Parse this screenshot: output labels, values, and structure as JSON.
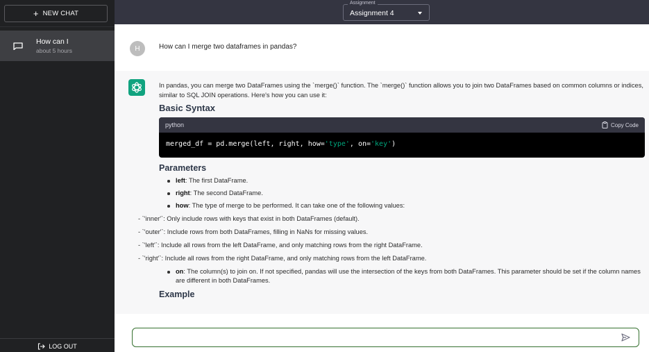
{
  "sidebar": {
    "new_chat_label": "NEW CHAT",
    "chats": [
      {
        "title": "How can I",
        "time": "about 5 hours"
      }
    ],
    "logout_label": "LOG OUT"
  },
  "header": {
    "assignment_label": "Assignment",
    "assignment_value": "Assignment 4"
  },
  "messages": {
    "user": {
      "avatar_letter": "H",
      "text": "How can I merge two dataframes in pandas?"
    },
    "assistant": {
      "intro": "In pandas, you can merge two DataFrames using the `merge()` function. The `merge()` function allows you to join two DataFrames based on common columns or indices, similar to SQL JOIN operations. Here's how you can use it:",
      "heading_basic": "Basic Syntax",
      "code": {
        "language": "python",
        "copy_label": "Copy Code",
        "part1": "merged_df = pd.merge(left, right, how=",
        "str1": "'type'",
        "part2": ", on=",
        "str2": "'key'",
        "part3": ")"
      },
      "heading_params": "Parameters",
      "params": [
        {
          "name": "left",
          "desc": ": The first DataFrame."
        },
        {
          "name": "right",
          "desc": ": The second DataFrame."
        },
        {
          "name": "how",
          "desc": ": The type of merge to be performed. It can take one of the following values:"
        }
      ],
      "how_values": [
        "- `'inner'`: Only include rows with keys that exist in both DataFrames (default).",
        "- `'outer'`: Include rows from both DataFrames, filling in NaNs for missing values.",
        "- `'left'`: Include all rows from the left DataFrame, and only matching rows from the right DataFrame.",
        "- `'right'`: Include all rows from the right DataFrame, and only matching rows from the left DataFrame."
      ],
      "param_on": {
        "name": "on",
        "desc": ": The column(s) to join on. If not specified, pandas will use the intersection of the keys from both DataFrames. This parameter should be set if the column names are different in both DataFrames."
      },
      "heading_example": "Example"
    }
  },
  "input": {
    "value": "",
    "placeholder": ""
  },
  "colors": {
    "sidebar_bg": "#202123",
    "header_bg": "#343541",
    "assistant_bg": "#f7f7f8",
    "gpt_avatar": "#10a37f",
    "input_border": "#35702f",
    "code_string": "#00a67d"
  },
  "icons": {
    "new_chat": "plus-icon",
    "chat": "chat-bubble-icon",
    "logout": "logout-icon",
    "copy": "clipboard-icon",
    "send": "send-icon",
    "assistant_avatar": "openai-logo-icon"
  }
}
